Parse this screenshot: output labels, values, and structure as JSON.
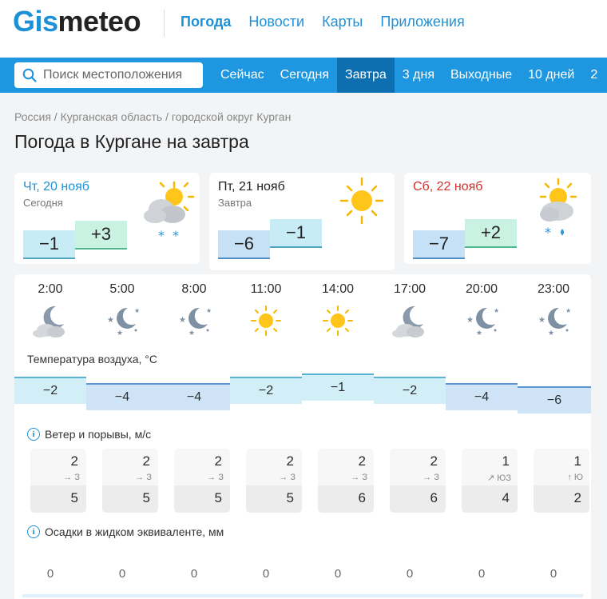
{
  "header": {
    "logo_part1": "Gis",
    "logo_part2": "meteo",
    "nav": [
      "Погода",
      "Новости",
      "Карты",
      "Приложения"
    ]
  },
  "search": {
    "placeholder": "Поиск местоположения"
  },
  "tabs": [
    "Сейчас",
    "Сегодня",
    "Завтра",
    "3 дня",
    "Выходные",
    "10 дней",
    "2"
  ],
  "active_tab": "Завтра",
  "breadcrumb": "Россия / Курганская область / городской округ Курган",
  "title": "Погода в Кургане на завтра",
  "days": [
    {
      "name": "Чт, 20 нояб",
      "sub": "Сегодня",
      "min": "−1",
      "max": "+3",
      "name_color": "#1e91d6",
      "icon": "partly-cloudy-snow-icon"
    },
    {
      "name": "Пт, 21 нояб",
      "sub": "Завтра",
      "min": "−6",
      "max": "−1",
      "name_color": "#222222",
      "icon": "sun-icon"
    },
    {
      "name": "Сб, 22 нояб",
      "sub": "",
      "min": "−7",
      "max": "+2",
      "name_color": "#d0312d",
      "icon": "partly-cloudy-rain-snow-icon"
    }
  ],
  "hourly": {
    "times": [
      "2:00",
      "5:00",
      "8:00",
      "11:00",
      "14:00",
      "17:00",
      "20:00",
      "23:00"
    ],
    "icons": [
      "cloudy-night-icon",
      "clear-night-icon",
      "clear-night-icon",
      "sun-icon",
      "sun-icon",
      "cloudy-night-icon",
      "clear-night-icon",
      "clear-night-icon"
    ],
    "temp_label": "Температура воздуха, °C",
    "temps": [
      "−2",
      "−4",
      "−4",
      "−2",
      "−1",
      "−2",
      "−4",
      "−6"
    ],
    "wind_label": "Ветер и порывы, м/с",
    "wind": [
      {
        "speed": "2",
        "dir": "→ З",
        "gust": "5"
      },
      {
        "speed": "2",
        "dir": "→ З",
        "gust": "5"
      },
      {
        "speed": "2",
        "dir": "→ З",
        "gust": "5"
      },
      {
        "speed": "2",
        "dir": "→ З",
        "gust": "5"
      },
      {
        "speed": "2",
        "dir": "→ З",
        "gust": "6"
      },
      {
        "speed": "2",
        "dir": "→ З",
        "gust": "6"
      },
      {
        "speed": "1",
        "dir": "↗ ЮЗ",
        "gust": "4"
      },
      {
        "speed": "1",
        "dir": "↑ Ю",
        "gust": "2"
      }
    ],
    "precip_label": "Осадки в жидком эквиваленте, мм",
    "precip": [
      "0",
      "0",
      "0",
      "0",
      "0",
      "0",
      "0",
      "0"
    ]
  },
  "colors": {
    "brand": "#1e91d6",
    "navbar": "#1e96e0",
    "active_tab": "#0d6fb0"
  }
}
